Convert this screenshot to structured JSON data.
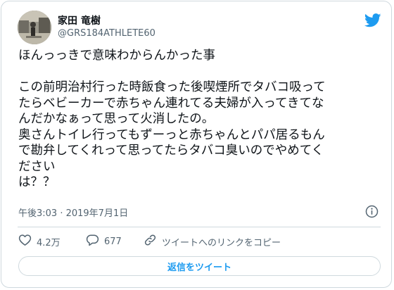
{
  "author": {
    "display_name": "家田 竜樹",
    "handle": "@GRS184ATHLETE60"
  },
  "icons": {
    "brand": "twitter-bird-icon",
    "info": "info-circle-icon",
    "like": "heart-icon",
    "reply": "speech-bubble-icon",
    "share": "link-icon"
  },
  "tweet": {
    "lines": [
      "ほんっっきで意味わからんかった事",
      "",
      "この前明治村行った時飯食った後喫煙所でタバコ吸って",
      "たらベビーカーで赤ちゃん連れてる夫婦が入ってきてな",
      "んだかなぁって思って火消したの。",
      "奥さんトイレ行ってもずーっと赤ちゃんとパパ居るもん",
      "で勘弁してくれって思ってたらタバコ臭いのでやめてく",
      "ださい",
      "は？？"
    ]
  },
  "meta": {
    "timestamp": "午後3:03 · 2019年7月1日"
  },
  "actions": {
    "likes": "4.2万",
    "replies": "677",
    "copy_link": "ツイートへのリンクをコピー"
  },
  "reply_button": {
    "label": "返信をツイート"
  },
  "colors": {
    "accent": "#1d9bf0",
    "text": "#0f1419",
    "secondary": "#536471",
    "border": "#cfd9de"
  }
}
